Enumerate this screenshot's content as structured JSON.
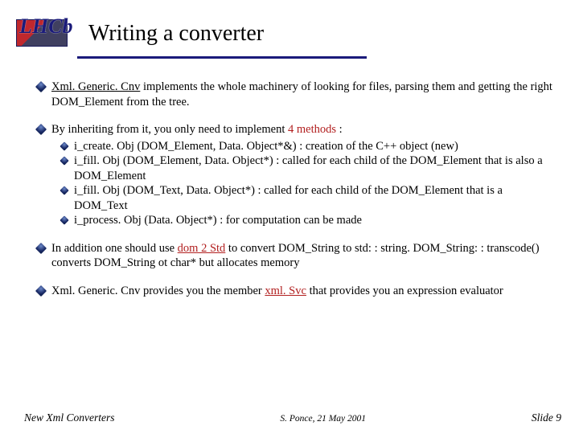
{
  "logo_text": "LHCb",
  "title": "Writing a converter",
  "bullets": {
    "b1": {
      "text_before": "Xml. Generic. Cnv",
      "text_after": " implements the whole machinery of looking for files, parsing them and getting the right DOM_Element from the tree."
    },
    "b2": {
      "lead": "By inheriting from it, you only need to implement ",
      "accent": "4 methods",
      "tail": " :",
      "subs": {
        "s1": "i_create. Obj (DOM_Element, Data. Object*&) : creation of the C++ object (new)",
        "s2": "i_fill. Obj (DOM_Element, Data. Object*) : called for each child of the DOM_Element that is also a DOM_Element",
        "s3": "i_fill. Obj (DOM_Text, Data. Object*) : called for each child of the DOM_Element that is a DOM_Text",
        "s4": "i_process. Obj (Data. Object*) : for computation can be made"
      }
    },
    "b3": {
      "lead": "In addition one should use ",
      "accent": "dom 2 Std",
      "tail": " to convert DOM_String to std: : string. DOM_String: : transcode() converts DOM_String ot char* but allocates memory"
    },
    "b4": {
      "lead": "Xml. Generic. Cnv provides you the member ",
      "accent": "xml. Svc",
      "tail": " that provides you an expression evaluator"
    }
  },
  "footer": {
    "left": "New Xml Converters",
    "center": "S. Ponce,  21 May 2001",
    "right": "Slide 9"
  }
}
